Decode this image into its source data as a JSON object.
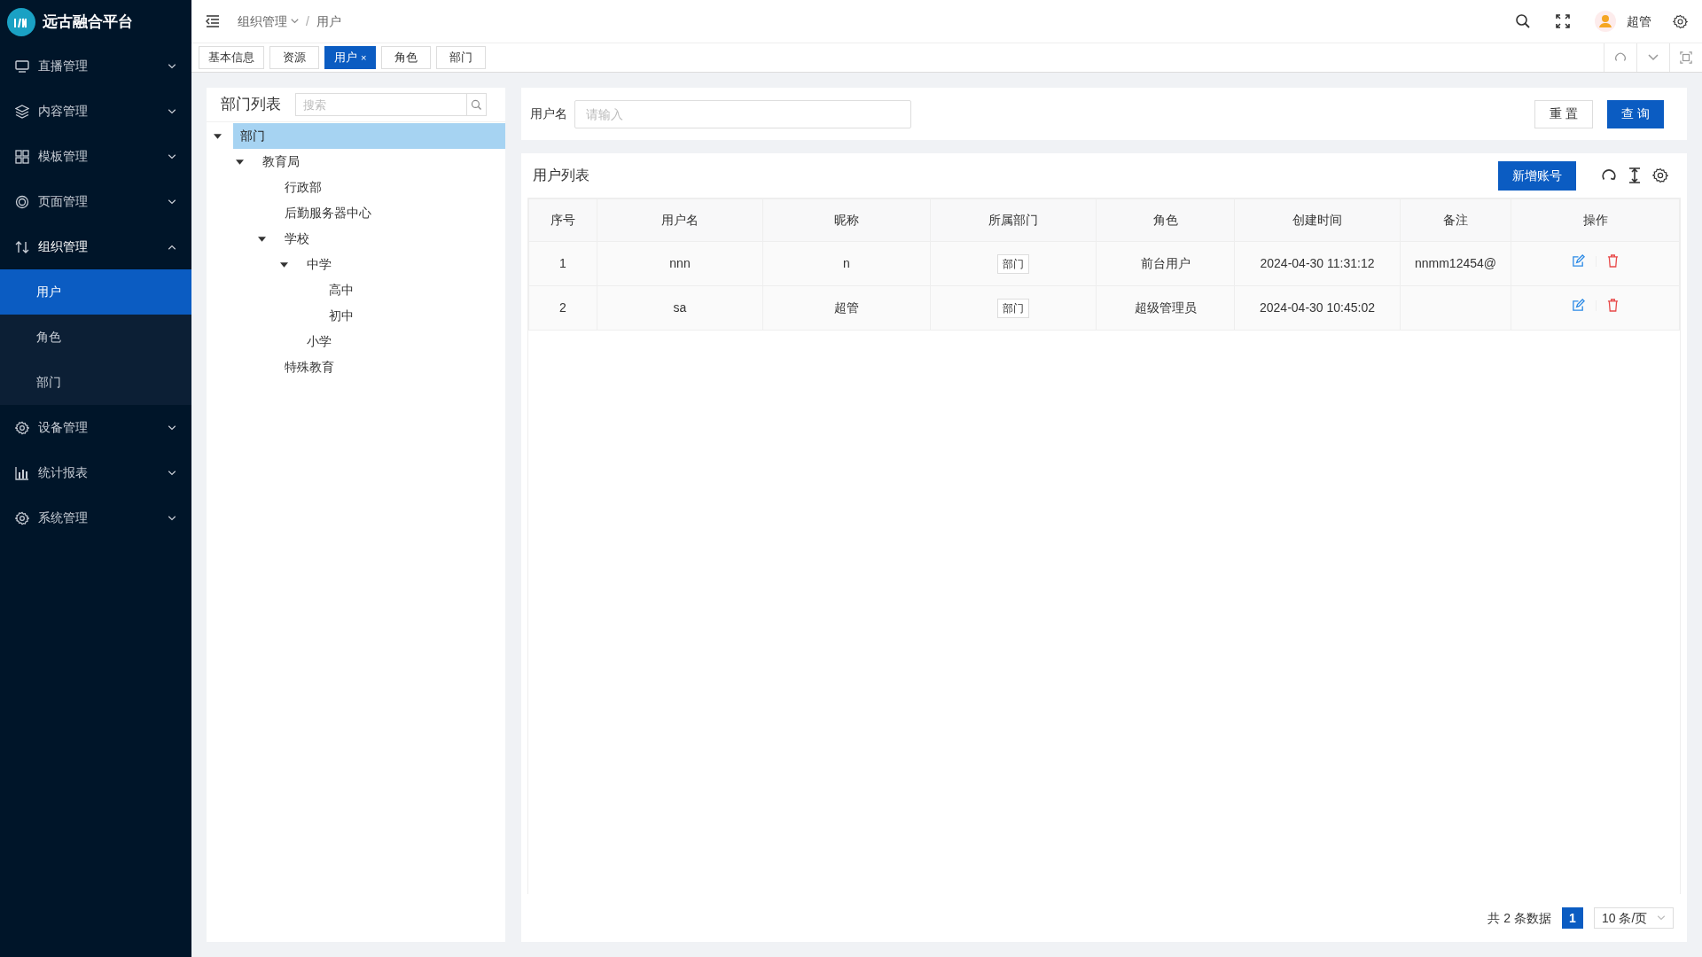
{
  "brand": {
    "title": "远古融合平台"
  },
  "sidebar": {
    "items": [
      {
        "label": "直播管理",
        "expanded": false
      },
      {
        "label": "内容管理",
        "expanded": false
      },
      {
        "label": "模板管理",
        "expanded": false
      },
      {
        "label": "页面管理",
        "expanded": false
      },
      {
        "label": "组织管理",
        "expanded": true,
        "children": [
          {
            "label": "用户",
            "selected": true
          },
          {
            "label": "角色",
            "selected": false
          },
          {
            "label": "部门",
            "selected": false
          }
        ]
      },
      {
        "label": "设备管理",
        "expanded": false
      },
      {
        "label": "统计报表",
        "expanded": false
      },
      {
        "label": "系统管理",
        "expanded": false
      }
    ]
  },
  "header": {
    "separator": "/",
    "breadcrumb": [
      {
        "label": "组织管理",
        "dropdown": true
      },
      {
        "label": "用户",
        "dropdown": false
      }
    ],
    "user_name": "超管"
  },
  "tabs": [
    {
      "label": "基本信息",
      "selected": false,
      "closable": false
    },
    {
      "label": "资源",
      "selected": false,
      "closable": false
    },
    {
      "label": "用户",
      "selected": true,
      "closable": true,
      "close": "×"
    },
    {
      "label": "角色",
      "selected": false,
      "closable": false
    },
    {
      "label": "部门",
      "selected": false,
      "closable": false
    }
  ],
  "dept_panel": {
    "title": "部门列表",
    "search_placeholder": "搜索",
    "tree": [
      {
        "label": "部门",
        "selected": true,
        "expanded": true,
        "children": [
          {
            "label": "教育局",
            "selected": false,
            "expanded": true,
            "children": [
              {
                "label": "行政部",
                "selected": false,
                "expanded": false
              },
              {
                "label": "后勤服务器中心",
                "selected": false,
                "expanded": false
              },
              {
                "label": "学校",
                "selected": false,
                "expanded": true,
                "children": [
                  {
                    "label": "中学",
                    "selected": false,
                    "expanded": true,
                    "children": [
                      {
                        "label": "高中",
                        "selected": false,
                        "expanded": false
                      },
                      {
                        "label": "初中",
                        "selected": false,
                        "expanded": false
                      }
                    ]
                  },
                  {
                    "label": "小学",
                    "selected": false,
                    "expanded": false
                  }
                ]
              },
              {
                "label": "特殊教育",
                "selected": false,
                "expanded": false
              }
            ]
          }
        ]
      }
    ]
  },
  "search_form": {
    "label": "用户名",
    "placeholder": "请输入",
    "reset_button": "重 置",
    "query_button": "查 询"
  },
  "user_table": {
    "title": "用户列表",
    "add_button": "新增账号",
    "columns": [
      "序号",
      "用户名",
      "昵称",
      "所属部门",
      "角色",
      "创建时间",
      "备注",
      "操作"
    ],
    "rows": [
      {
        "index": "1",
        "username": "nnn",
        "nickname": "n",
        "department": "部门",
        "role": "前台用户",
        "created": "2024-04-30 11:31:12",
        "remark": "nnmm12454@"
      },
      {
        "index": "2",
        "username": "sa",
        "nickname": "超管",
        "department": "部门",
        "role": "超级管理员",
        "created": "2024-04-30 10:45:02"
      }
    ]
  },
  "pagination": {
    "total": "共 2 条数据",
    "pages": [
      {
        "label": "1",
        "selected": true
      }
    ],
    "page_size": "10 条/页"
  }
}
